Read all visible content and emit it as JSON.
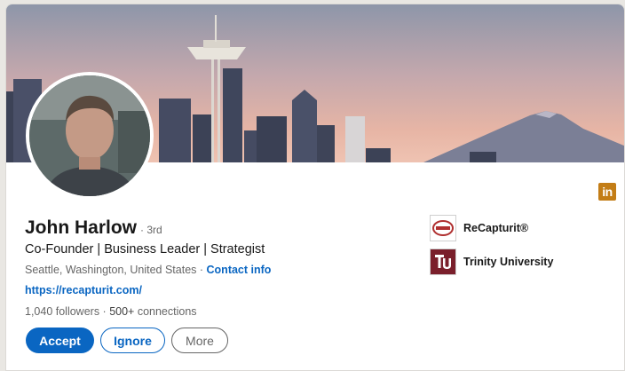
{
  "profile": {
    "name": "John Harlow",
    "degree": "· 3rd",
    "headline": "Co-Founder | Business Leader | Strategist",
    "location": "Seattle, Washington, United States",
    "separator": " · ",
    "contact_info": "Contact info",
    "website": "https://recapturit.com/",
    "followers": "1,040 followers",
    "stats_separator": " · ",
    "connections_count": "500+",
    "connections_label": " connections"
  },
  "actions": {
    "accept": "Accept",
    "ignore": "Ignore",
    "more": "More"
  },
  "organizations": [
    {
      "name": "ReCapturit®",
      "logo": "recapturit-logo"
    },
    {
      "name": "Trinity University",
      "logo": "trinity-university-logo"
    }
  ],
  "icons": {
    "linkedin": "in"
  },
  "colors": {
    "accent": "#0a66c2",
    "linkedin_badge": "#c37d16",
    "secondary_text": "#666666"
  }
}
